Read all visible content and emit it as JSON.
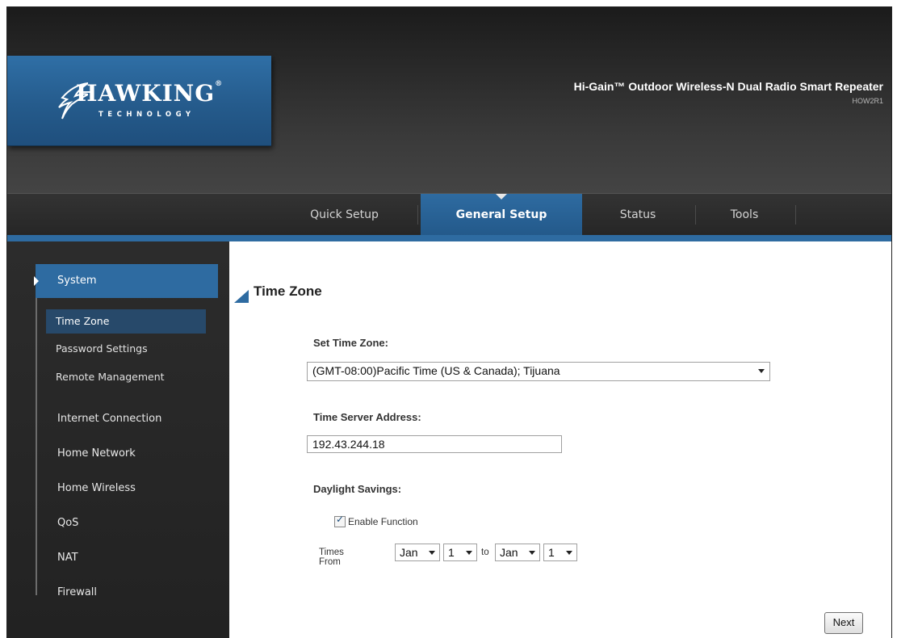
{
  "brand": {
    "name": "HAWKING",
    "sub": "TECHNOLOGY",
    "reg": "®"
  },
  "product": {
    "title": "Hi-Gain™ Outdoor Wireless-N Dual Radio Smart Repeater",
    "model": "HOW2R1"
  },
  "nav": {
    "tabs": [
      {
        "label": "Quick Setup"
      },
      {
        "label": "General Setup",
        "active": true
      },
      {
        "label": "Status"
      },
      {
        "label": "Tools"
      }
    ]
  },
  "sidebar": {
    "system": "System",
    "sub": [
      {
        "label": "Time Zone",
        "active": true
      },
      {
        "label": "Password Settings"
      },
      {
        "label": "Remote Management"
      }
    ],
    "items": [
      {
        "label": "Internet Connection"
      },
      {
        "label": "Home Network"
      },
      {
        "label": "Home Wireless"
      },
      {
        "label": "QoS"
      },
      {
        "label": "NAT"
      },
      {
        "label": "Firewall"
      }
    ]
  },
  "main": {
    "title": "Time Zone",
    "set_tz_label": "Set Time Zone:",
    "tz_value": "(GMT-08:00)Pacific Time (US & Canada); Tijuana",
    "server_label": "Time Server Address:",
    "server_value": "192.43.244.18",
    "dst_label": "Daylight Savings:",
    "enable_label": "Enable Function",
    "enable_checked": true,
    "times_from": "Times From",
    "to": "to",
    "from_month": "Jan",
    "from_day": "1",
    "to_month": "Jan",
    "to_day": "1",
    "next": "Next"
  },
  "colors": {
    "accent": "#2e6ba1",
    "header_dark": "#262626"
  }
}
